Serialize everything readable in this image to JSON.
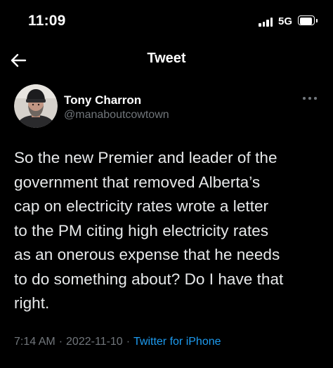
{
  "status_bar": {
    "time": "11:09",
    "network": "5G",
    "signal_icon": "cellular-signal-icon",
    "battery_icon": "battery-icon"
  },
  "header": {
    "title": "Tweet",
    "back_icon": "back-arrow-icon"
  },
  "author": {
    "name": "Tony Charron",
    "handle": "@manaboutcowtown",
    "avatar_icon": "user-avatar",
    "more_icon": "more-options-icon"
  },
  "tweet": {
    "lines": [
      "So the new Premier and leader of the",
      "government that removed Alberta’s",
      "cap on electricity rates wrote a letter",
      "to the PM citing high electricity rates",
      "as an onerous expense that he needs",
      "to do something about? Do I have that",
      "right."
    ],
    "time": "7:14 AM",
    "separator": "·",
    "date": "2022-11-10",
    "source": "Twitter for iPhone"
  },
  "colors": {
    "background": "#000000",
    "text": "#e7e9ea",
    "secondary_text": "#71767b",
    "accent": "#1d9bf0"
  }
}
